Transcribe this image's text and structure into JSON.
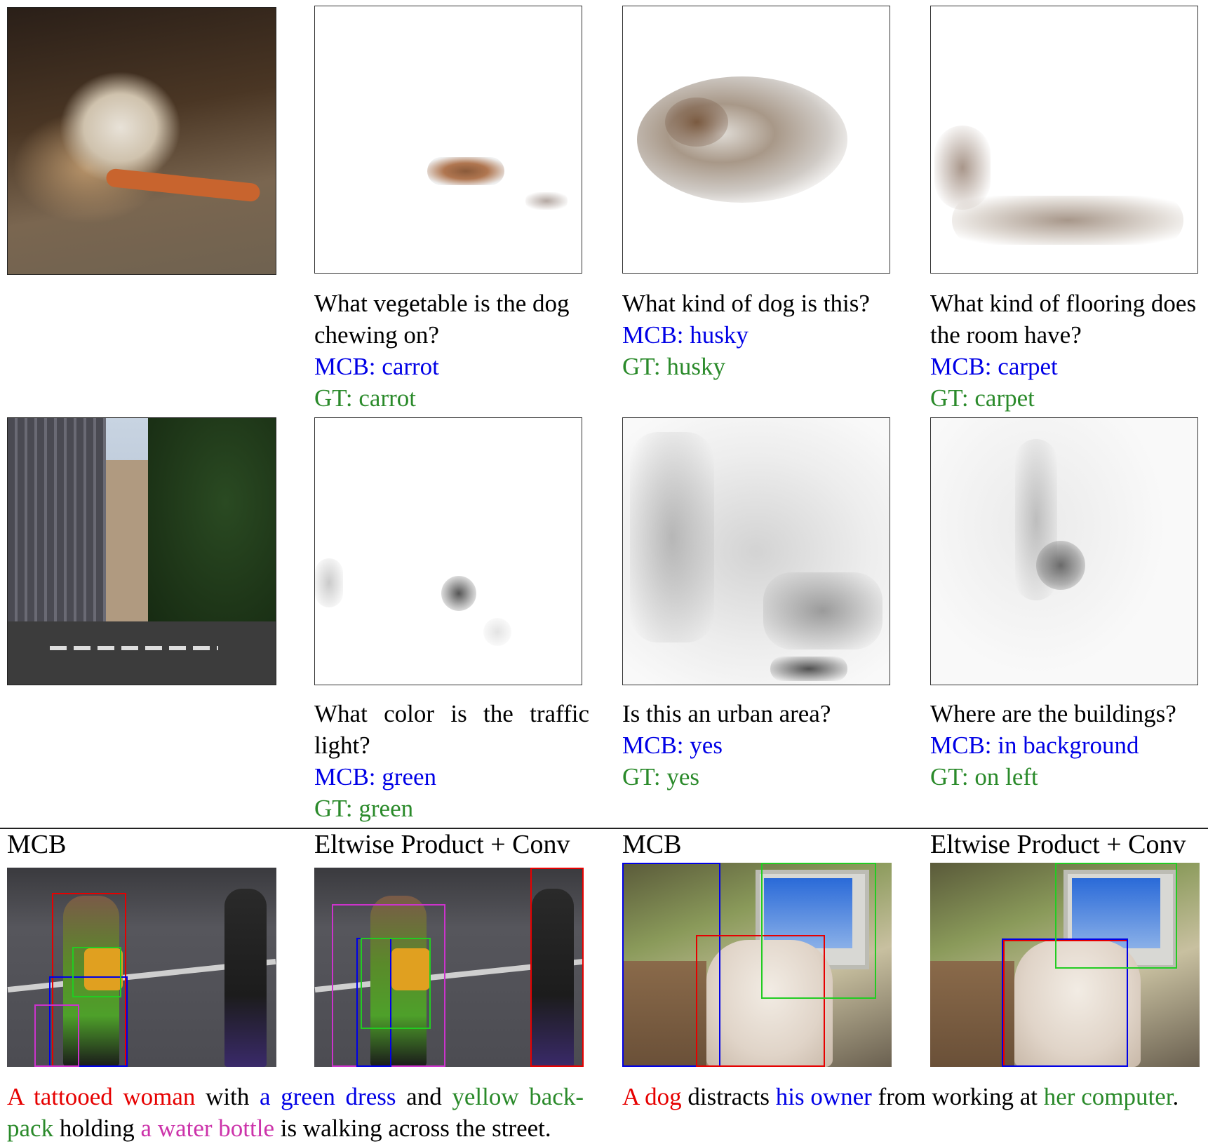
{
  "rows": [
    {
      "captions": [
        {
          "question_lines": [
            "What vegetable is the dog",
            "chewing on?"
          ],
          "mcb": "MCB: carrot",
          "gt": "GT: carrot"
        },
        {
          "question_lines": [
            "What kind of dog is this?"
          ],
          "mcb": "MCB: husky",
          "gt": "GT: husky"
        },
        {
          "question_lines": [
            "What kind of flooring does",
            "the room have?"
          ],
          "mcb": "MCB: carpet",
          "gt": "GT: carpet"
        }
      ]
    },
    {
      "captions": [
        {
          "question_lines": [
            "What color is the traffic",
            "light?"
          ],
          "mcb": "MCB: green",
          "gt": "GT: green"
        },
        {
          "question_lines": [
            "Is this an urban area?"
          ],
          "mcb": "MCB: yes",
          "gt": "GT: yes"
        },
        {
          "question_lines": [
            "Where are the buildings?"
          ],
          "mcb": "MCB: in background",
          "gt": "GT: on left"
        }
      ]
    }
  ],
  "bottom": {
    "headers": [
      "MCB",
      "Eltwise Product + Conv",
      "MCB",
      "Eltwise Product + Conv"
    ],
    "caption_left": {
      "line1": [
        {
          "text": "A tattooed woman",
          "color": "red"
        },
        {
          "text": " with ",
          "color": "black"
        },
        {
          "text": "a green dress",
          "color": "blue"
        },
        {
          "text": " and ",
          "color": "black"
        },
        {
          "text": "yellow back-",
          "color": "green"
        }
      ],
      "line2": [
        {
          "text": "pack",
          "color": "green"
        },
        {
          "text": " holding ",
          "color": "black"
        },
        {
          "text": "a water bottle",
          "color": "magenta"
        },
        {
          "text": " is walking across the street.",
          "color": "black"
        }
      ]
    },
    "caption_right": {
      "line1": [
        {
          "text": "A dog",
          "color": "red"
        },
        {
          "text": " distracts ",
          "color": "black"
        },
        {
          "text": "his owner",
          "color": "blue"
        },
        {
          "text": " from working at ",
          "color": "black"
        },
        {
          "text": "her computer",
          "color": "green"
        },
        {
          "text": ".",
          "color": "black"
        }
      ]
    }
  },
  "colors": {
    "mcb_answer": "#0000e6",
    "ground_truth": "#2a8a2a",
    "box_red": "#e60000",
    "box_blue": "#0000e6",
    "box_green": "#22cc22",
    "box_magenta": "#cc33cc"
  }
}
